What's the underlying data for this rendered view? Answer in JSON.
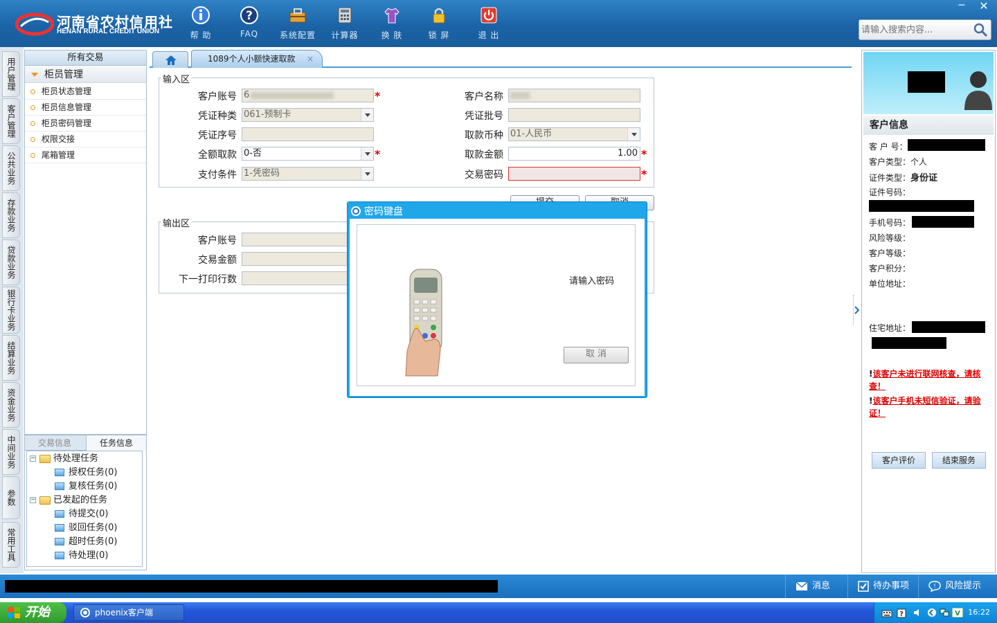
{
  "header": {
    "logo_cn": "河南省农村信用社",
    "logo_en": "HENAN RURAL CREDIT UNION",
    "toolbar": [
      {
        "label": "帮 助",
        "icon": "info-icon"
      },
      {
        "label": "FAQ",
        "icon": "help-icon"
      },
      {
        "label": "系统配置",
        "icon": "toolbox-icon"
      },
      {
        "label": "计算器",
        "icon": "calculator-icon"
      },
      {
        "label": "换 肤",
        "icon": "shirt-icon"
      },
      {
        "label": "锁 屏",
        "icon": "lock-icon"
      },
      {
        "label": "退 出",
        "icon": "power-icon"
      }
    ],
    "window_min": "─",
    "window_close": "✕",
    "search_placeholder": "请输入搜索内容..."
  },
  "vertical_tabs": [
    "用户管理",
    "客户管理",
    "公共业务",
    "存款业务",
    "贷款业务",
    "银行卡业务",
    "结算业务",
    "资金业务",
    "中间业务",
    "参数",
    "常用工具"
  ],
  "menu": {
    "header": "所有交易",
    "group": "柜员管理",
    "items": [
      "柜员状态管理",
      "柜员信息管理",
      "柜员密码管理",
      "权限交接",
      "尾箱管理"
    ]
  },
  "task_panel": {
    "tabs": [
      "交易信息",
      "任务信息"
    ],
    "tree": [
      {
        "label": "待处理任务",
        "children": [
          "授权任务(0)",
          "复核任务(0)"
        ]
      },
      {
        "label": "已发起的任务",
        "children": [
          "待提交(0)",
          "驳回任务(0)",
          "超时任务(0)",
          "待处理(0)"
        ]
      }
    ]
  },
  "work_tabs": {
    "active": "1089个人小额快速取款",
    "close": "×"
  },
  "input_area": {
    "legend": "输入区",
    "fields": {
      "account_label": "客户账号",
      "account_value": "6",
      "name_label": "客户名称",
      "name_value": "",
      "voucher_type_label": "凭证种类",
      "voucher_type_value": "061-预制卡",
      "voucher_batch_label": "凭证批号",
      "voucher_batch_value": "",
      "voucher_seq_label": "凭证序号",
      "voucher_seq_value": "",
      "currency_label": "取款币种",
      "currency_value": "01-人民币",
      "full_withdraw_label": "全额取款",
      "full_withdraw_value": "0-否",
      "amount_label": "取款金额",
      "amount_value": "1.00",
      "pay_cond_label": "支付条件",
      "pay_cond_value": "1-凭密码",
      "password_label": "交易密码",
      "password_value": ""
    },
    "required_mark": "*",
    "submit": "提交",
    "cancel": "取消"
  },
  "output_area": {
    "legend": "输出区",
    "account_label": "客户账号",
    "amount_label": "交易金额",
    "print_label": "下一打印行数"
  },
  "dialog": {
    "title": "密码键盘",
    "prompt": "请输入密码",
    "cancel": "取 消"
  },
  "customer": {
    "title": "客户信息",
    "id_label": "客 户 号：",
    "type_label": "客户类型：",
    "type_value": "个人",
    "cert_type_label": "证件类型：",
    "cert_type_value": "身份证",
    "cert_no_label": "证件号码：",
    "phone_label": "手机号码：",
    "risk_label": "风险等级：",
    "level_label": "客户等级：",
    "points_label": "客户积分：",
    "company_addr_label": "单位地址：",
    "home_addr_label": "住宅地址：",
    "warning1": "该客户未进行联网核查，请核查！",
    "warning2": "该客户手机未短信验证，请验证！",
    "warn_mark": "!",
    "btn_rate": "客户评价",
    "btn_end": "结束服务"
  },
  "statusbar": {
    "messages": "消息",
    "todo": "待办事项",
    "risk": "风险提示"
  },
  "taskbar": {
    "start": "开始",
    "app": "phoenix客户端",
    "clock": "16:22"
  },
  "colors": {
    "header_blue": "#1b63a6",
    "dialog_blue": "#1fa7ea",
    "required_red": "#d00000"
  }
}
